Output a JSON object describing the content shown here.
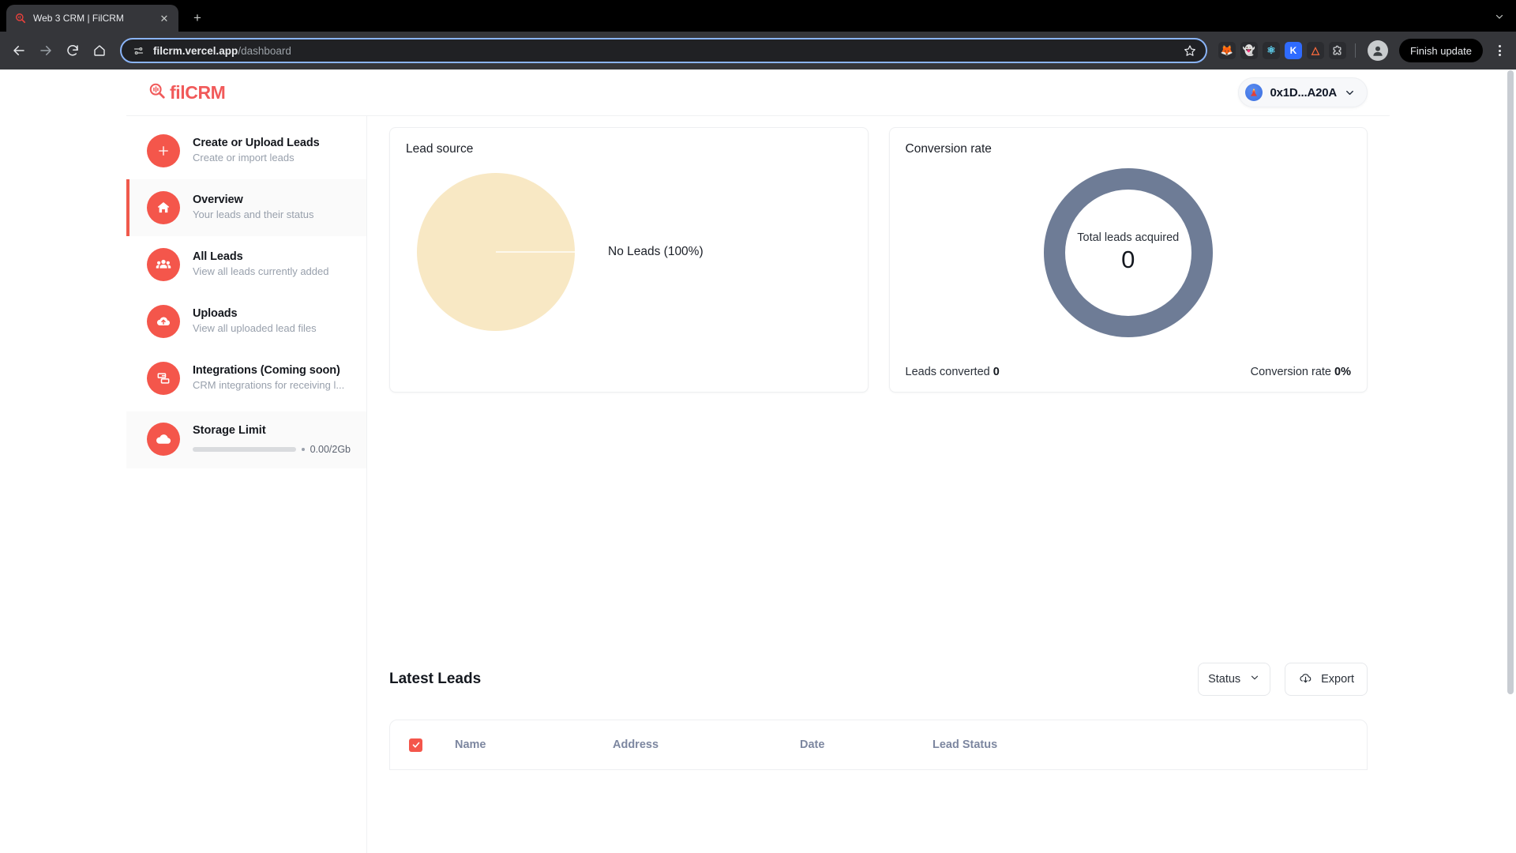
{
  "browser": {
    "tab": {
      "title": "Web 3 CRM | FilCRM",
      "favicon_icon": "filcrm-magnifier-icon",
      "close_icon": "close-icon"
    },
    "new_tab_label": "+",
    "tab_list_chevron": "chevron-down-icon",
    "nav": {
      "back_icon": "arrow-left-icon",
      "forward_icon": "arrow-right-icon",
      "reload_icon": "reload-icon",
      "home_icon": "home-icon"
    },
    "omnibox": {
      "site_settings_icon": "tune-icon",
      "url_host": "filcrm.vercel.app",
      "url_path": "/dashboard",
      "bookmark_icon": "star-icon"
    },
    "extensions": [
      {
        "name": "metamask-extension-icon",
        "glyph": "🦊",
        "bg": "#2B2C30"
      },
      {
        "name": "phantom-extension-icon",
        "glyph": "👻",
        "bg": "#2B2C30"
      },
      {
        "name": "react-devtools-extension-icon",
        "glyph": "⚛",
        "bg": "#2B2C30",
        "color": "#61DAFB"
      },
      {
        "name": "keplr-extension-icon",
        "glyph": "K",
        "bg": "#2F6BFF",
        "color": "#FFFFFF"
      },
      {
        "name": "argent-extension-icon",
        "glyph": "🅰",
        "bg": "#2B2C30",
        "color": "#FF6B3D"
      },
      {
        "name": "extensions-puzzle-icon",
        "glyph": "🧩",
        "bg": "#2B2C30"
      }
    ],
    "profile_avatar": "profile-avatar",
    "finish_update_label": "Finish update",
    "menu_icon": "kebab-menu-icon"
  },
  "app": {
    "logo": {
      "text": "filCRM",
      "icon": "magnifier-logo-icon"
    },
    "wallet": {
      "address": "0x1D...A20A",
      "avatar_icon": "wallet-avatar-icon",
      "chevron_icon": "chevron-down-icon"
    }
  },
  "sidebar": {
    "items": [
      {
        "title": "Create or Upload Leads",
        "subtitle": "Create or import leads",
        "icon": "plus-icon",
        "active": false
      },
      {
        "title": "Overview",
        "subtitle": "Your leads and their status",
        "icon": "home-icon",
        "active": true
      },
      {
        "title": "All Leads",
        "subtitle": "View all leads currently added",
        "icon": "users-icon",
        "active": false
      },
      {
        "title": "Uploads",
        "subtitle": "View all uploaded lead files",
        "icon": "cloud-upload-icon",
        "active": false
      },
      {
        "title": "Integrations (Coming soon)",
        "subtitle": "CRM integrations for receiving l...",
        "icon": "integrations-icon",
        "active": false
      }
    ],
    "storage": {
      "title": "Storage Limit",
      "icon": "cloud-icon",
      "value": "0.00/2Gb",
      "bullet": "•",
      "progress_percent": 0
    }
  },
  "main": {
    "lead_source_card": {
      "title": "Lead source",
      "legend_label": "No Leads (100%)"
    },
    "conversion_card": {
      "title": "Conversion rate",
      "center_caption": "Total leads acquired",
      "center_value": "0",
      "foot_left_label": "Leads converted",
      "foot_left_value": "0",
      "foot_right_label": "Conversion rate",
      "foot_right_value": "0%"
    },
    "latest_leads": {
      "title": "Latest Leads",
      "status_filter": {
        "label": "Status",
        "chevron_icon": "chevron-down-icon"
      },
      "export_button": {
        "label": "Export",
        "icon": "export-cloud-icon"
      },
      "table": {
        "select_all_checked": true,
        "columns": [
          "Name",
          "Address",
          "Date",
          "Lead Status"
        ],
        "rows": []
      }
    }
  },
  "chart_data": [
    {
      "type": "pie",
      "title": "Lead source",
      "categories": [
        "No Leads"
      ],
      "values": [
        100
      ],
      "value_unit": "%",
      "labels": [
        "No Leads (100%)"
      ],
      "colors": [
        "#F8E8C4"
      ],
      "legend_position": "right"
    },
    {
      "type": "pie",
      "subtype": "donut",
      "title": "Conversion rate",
      "categories": [
        "Total leads acquired"
      ],
      "values": [
        0
      ],
      "center_label": "Total leads acquired",
      "center_value": 0,
      "annotations": [
        "Leads converted 0",
        "Conversion rate 0%"
      ],
      "colors": [
        "#6E7C96"
      ]
    }
  ],
  "colors": {
    "brand_red": "#F4564B",
    "pie_cream": "#F8E8C4",
    "donut_slate": "#6E7C96",
    "header_text": "#7D87A0"
  }
}
